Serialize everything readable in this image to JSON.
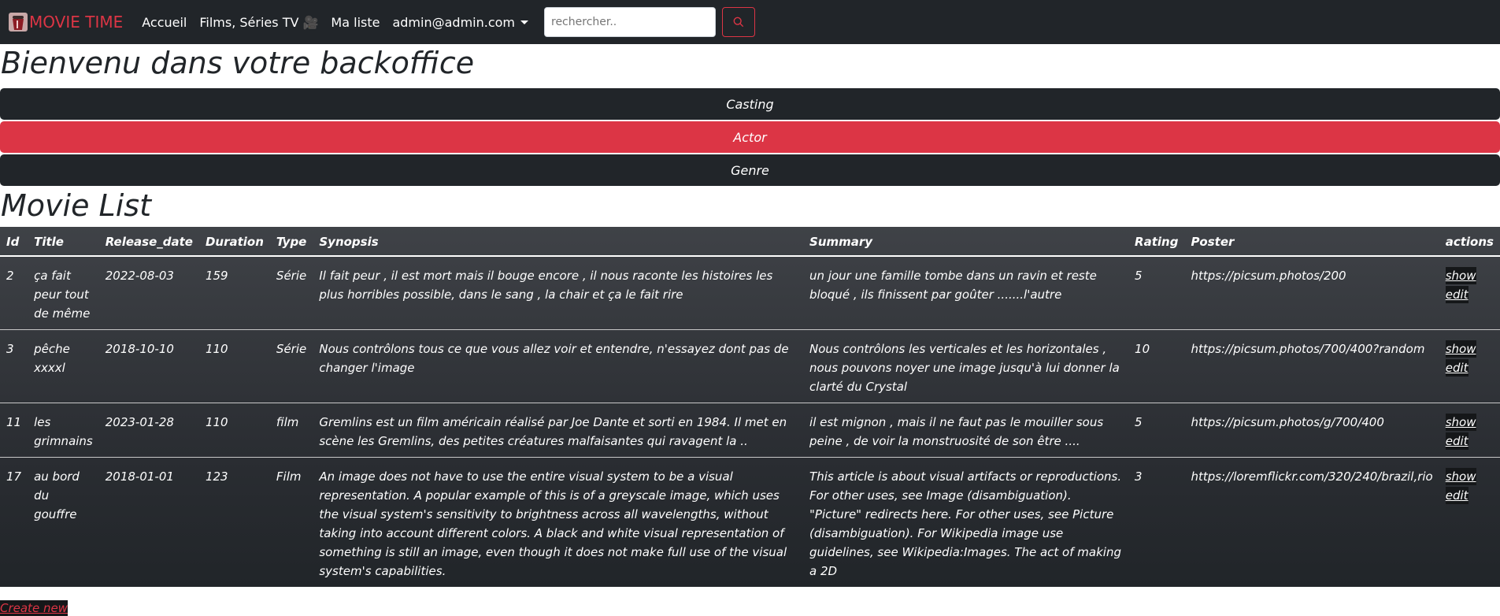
{
  "navbar": {
    "brand": "MOVIE TIME",
    "links": [
      "Accueil",
      "Films, Séries TV 🎥",
      "Ma liste"
    ],
    "user": "admin@admin.com",
    "search_placeholder": "rechercher.."
  },
  "page_title": "Bienvenu dans votre backoffice",
  "menu": [
    "Casting",
    "Actor",
    "Genre"
  ],
  "section_title": "Movie List",
  "table": {
    "headers": [
      "Id",
      "Title",
      "Release_date",
      "Duration",
      "Type",
      "Synopsis",
      "Summary",
      "Rating",
      "Poster",
      "actions"
    ],
    "rows": [
      {
        "id": "2",
        "title": "ça fait peur tout de même",
        "release_date": "2022-08-03",
        "duration": "159",
        "type": "Série",
        "synopsis": "Il fait peur , il est mort mais il bouge encore , il nous raconte les histoires les plus horribles possible, dans le sang , la chair et ça le fait rire",
        "summary": "un jour une famille tombe dans un ravin et reste bloqué , ils finissent par goûter .......l'autre",
        "rating": "5",
        "poster": "https://picsum.photos/200",
        "show": "show",
        "edit": "edit"
      },
      {
        "id": "3",
        "title": "pêche xxxxl",
        "release_date": "2018-10-10",
        "duration": "110",
        "type": "Série",
        "synopsis": "Nous contrôlons tous ce que vous allez voir et entendre, n'essayez dont pas de changer l'image",
        "summary": "Nous contrôlons les verticales et les horizontales , nous pouvons noyer une image jusqu'à lui donner la clarté du Crystal",
        "rating": "10",
        "poster": "https://picsum.photos/700/400?random",
        "show": "show",
        "edit": "edit"
      },
      {
        "id": "11",
        "title": "les grimnains",
        "release_date": "2023-01-28",
        "duration": "110",
        "type": "film",
        "synopsis": "Gremlins est un film américain réalisé par Joe Dante et sorti en 1984. Il met en scène les Gremlins, des petites créatures malfaisantes qui ravagent la ..",
        "summary": "il est mignon , mais il ne faut pas le mouiller sous peine , de voir la monstruosité de son être ....",
        "rating": "5",
        "poster": "https://picsum.photos/g/700/400",
        "show": "show",
        "edit": "edit"
      },
      {
        "id": "17",
        "title": "au bord du gouffre",
        "release_date": "2018-01-01",
        "duration": "123",
        "type": "Film",
        "synopsis": "An image does not have to use the entire visual system to be a visual representation. A popular example of this is of a greyscale image, which uses the visual system's sensitivity to brightness across all wavelengths, without taking into account different colors. A black and white visual representation of something is still an image, even though it does not make full use of the visual system's capabilities.",
        "summary": "This article is about visual artifacts or reproductions. For other uses, see Image (disambiguation). \"Picture\" redirects here. For other uses, see Picture (disambiguation). For Wikipedia image use guidelines, see Wikipedia:Images. The act of making a 2D",
        "rating": "3",
        "poster": "https://loremflickr.com/320/240/brazil,rio",
        "show": "show",
        "edit": "edit"
      }
    ]
  },
  "create_new": "Create new",
  "colors": {
    "navbar": "#212529",
    "accent": "#dc3545"
  },
  "icons": {
    "brand": "popcorn-icon",
    "search": "search-icon",
    "dropdown": "caret-down-icon"
  }
}
